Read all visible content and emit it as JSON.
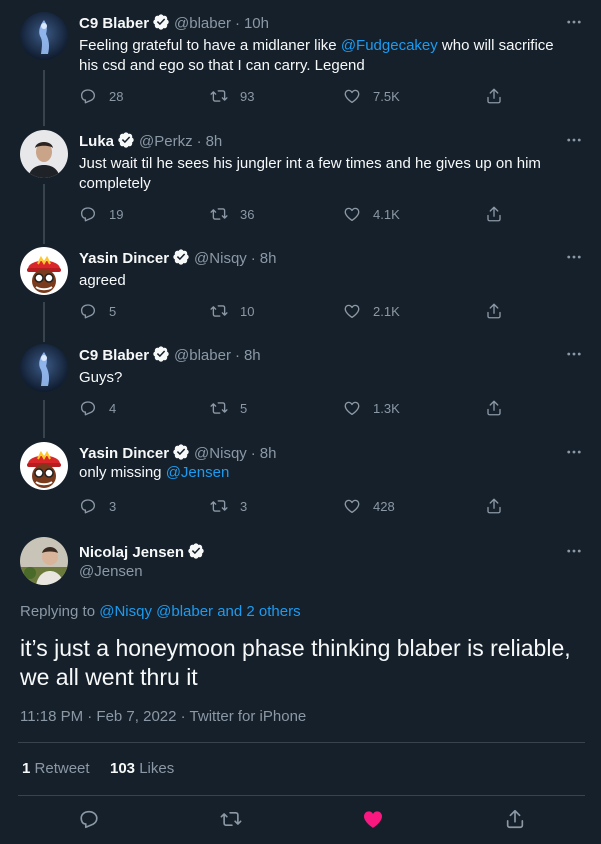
{
  "tweets": [
    {
      "name": "C9 Blaber",
      "handle": "@blaber",
      "time": "10h",
      "text_before": "Feeling grateful to have a midlaner like ",
      "mention": "@Fudgecakey",
      "text_after": "  who will sacrifice his csd and ego so that I can carry. Legend",
      "replies": "28",
      "retweets": "93",
      "likes": "7.5K"
    },
    {
      "name": "Luka",
      "handle": "@Perkz",
      "time": "8h",
      "text": "Just wait til he sees his jungler int a few times and he gives up on him completely",
      "replies": "19",
      "retweets": "36",
      "likes": "4.1K"
    },
    {
      "name": "Yasin Dincer",
      "handle": "@Nisqy",
      "time": "8h",
      "text": "agreed",
      "replies": "5",
      "retweets": "10",
      "likes": "2.1K"
    },
    {
      "name": "C9 Blaber",
      "handle": "@blaber",
      "time": "8h",
      "text": "Guys?",
      "replies": "4",
      "retweets": "5",
      "likes": "1.3K"
    },
    {
      "name": "Yasin Dincer",
      "handle": "@Nisqy",
      "time": "8h",
      "text_before": "only missing ",
      "mention": "@Jensen",
      "replies": "3",
      "retweets": "3",
      "likes": "428"
    }
  ],
  "main": {
    "name": "Nicolaj Jensen",
    "handle": "@Jensen",
    "replying_label": "Replying to ",
    "replying_to": "@Nisqy @blaber and 2 others",
    "text": "it’s just a honeymoon phase thinking blaber is reliable, we all went thru it",
    "meta": "11:18 PM · Feb 7, 2022 · Twitter for iPhone",
    "retweets_count": "1",
    "retweets_label": "Retweet",
    "likes_count": "103",
    "likes_label": "Likes"
  },
  "separator": "·",
  "colors": {
    "background": "#15202b",
    "text": "#f7f9f9",
    "muted": "#8b98a5",
    "link": "#1d9bf0",
    "like_active": "#f91880",
    "border": "#38444d"
  },
  "icons": [
    "verified-badge-icon",
    "more-icon",
    "reply-icon",
    "retweet-icon",
    "like-icon",
    "share-icon"
  ]
}
